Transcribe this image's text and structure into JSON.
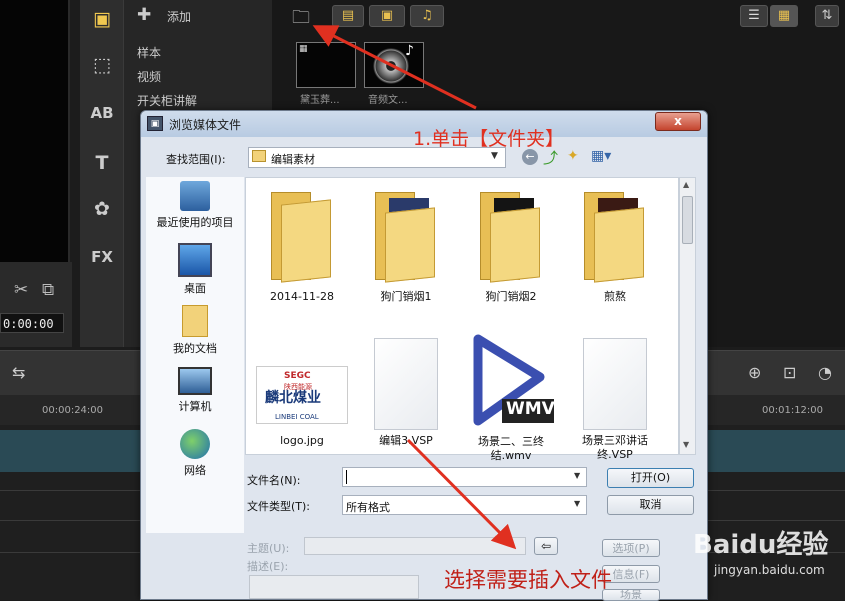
{
  "editor": {
    "timecode": "0:00:00",
    "add_label": "添加",
    "categories": [
      "样本",
      "视频",
      "开关柜讲解"
    ],
    "media_items": [
      {
        "label": "黛玉葬..."
      },
      {
        "label": "音频文..."
      }
    ],
    "ruler_times": [
      "00:00:24:00",
      "00:01:12:00"
    ],
    "side_icons": [
      "library-icon",
      "transition-icon",
      "title-ab-icon",
      "text-t-icon",
      "graphics-icon",
      "fx-icon"
    ],
    "side_labels": [
      "AB",
      "T",
      "FX"
    ]
  },
  "dialog": {
    "title": "浏览媒体文件",
    "close_symbol": "x",
    "look_in_label": "查找范围(I):",
    "look_in_value": "编辑素材",
    "places": [
      {
        "label": "最近使用的项目",
        "icon": "recent-items-icon"
      },
      {
        "label": "桌面",
        "icon": "desktop-icon"
      },
      {
        "label": "我的文档",
        "icon": "my-documents-icon"
      },
      {
        "label": "计算机",
        "icon": "computer-icon"
      },
      {
        "label": "网络",
        "icon": "network-icon"
      }
    ],
    "files_row1": [
      {
        "name": "2014-11-28",
        "type": "folder"
      },
      {
        "name": "狗门销烟1",
        "type": "folder"
      },
      {
        "name": "狗门销烟2",
        "type": "folder"
      },
      {
        "name": "煎熬",
        "type": "folder"
      }
    ],
    "files_row2": [
      {
        "name": "logo.jpg",
        "type": "image"
      },
      {
        "name": "编辑3.VSP",
        "type": "doc"
      },
      {
        "name": "场景二、三终结.wmv",
        "type": "wmv"
      },
      {
        "name": "场景三邓讲话终.VSP",
        "type": "doc"
      }
    ],
    "logo": {
      "top": "SEGC",
      "sub": "陕西能源",
      "cn": "麟北煤业",
      "en": "LINBEI COAL"
    },
    "wmv_badge": "WMV",
    "filename_label": "文件名(N):",
    "filename_value": "",
    "filetype_label": "文件类型(T):",
    "filetype_value": "所有格式",
    "open_button": "打开(O)",
    "cancel_button": "取消",
    "subject_label": "主题(U):",
    "desc_label": "描述(E):",
    "options_button": "选项(P)",
    "info_button": "信息(F)",
    "scene_button": "场景"
  },
  "annotations": {
    "step1": "1.单击【文件夹】",
    "step2": "选择需要插入文件"
  },
  "watermark": {
    "logo": "Baidu经验",
    "url": "jingyan.baidu.com"
  },
  "colors": {
    "annotation": "#e03020",
    "dialog_bg": "#dfe5ee",
    "folder": "#f2d27a"
  }
}
